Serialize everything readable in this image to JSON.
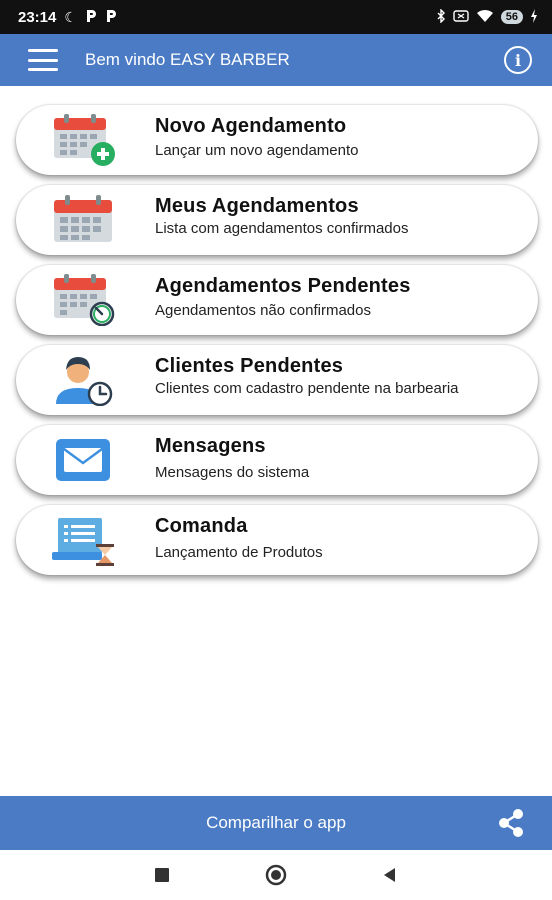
{
  "status_bar": {
    "time": "23:14",
    "battery": "56",
    "icons": [
      "moon-icon",
      "p-notification-icon",
      "bluetooth-icon",
      "sim-icon",
      "wifi-icon",
      "battery-icon",
      "charging-icon"
    ]
  },
  "app_bar": {
    "title": "Bem vindo EASY BARBER",
    "icons": [
      "hamburger-menu-icon",
      "info-icon"
    ]
  },
  "cards": [
    {
      "title": "Novo Agendamento",
      "subtitle": "Lançar um novo agendamento",
      "icon": "calendar-add-icon"
    },
    {
      "title": "Meus Agendamentos",
      "subtitle": "Lista com agendamentos confirmados",
      "icon": "calendar-icon"
    },
    {
      "title": "Agendamentos Pendentes",
      "subtitle": "Agendamentos não confirmados",
      "icon": "calendar-clock-icon"
    },
    {
      "title": "Clientes Pendentes",
      "subtitle": "Clientes com cadastro pendente na barbearia",
      "icon": "user-clock-icon"
    },
    {
      "title": "Mensagens",
      "subtitle": "Mensagens do sistema",
      "icon": "envelope-icon"
    },
    {
      "title": "Comanda",
      "subtitle": "Lançamento de Produtos",
      "icon": "order-hourglass-icon"
    }
  ],
  "share_bar": {
    "label": "Comparilhar o app",
    "icon": "share-icon"
  },
  "nav_bar": {
    "icons": [
      "recents-icon",
      "home-icon",
      "back-icon"
    ]
  },
  "colors": {
    "primary": "#4a7bc4",
    "calendar_red": "#e74c3c",
    "add_green": "#27ae60",
    "envelope_blue": "#3d8fe0"
  }
}
